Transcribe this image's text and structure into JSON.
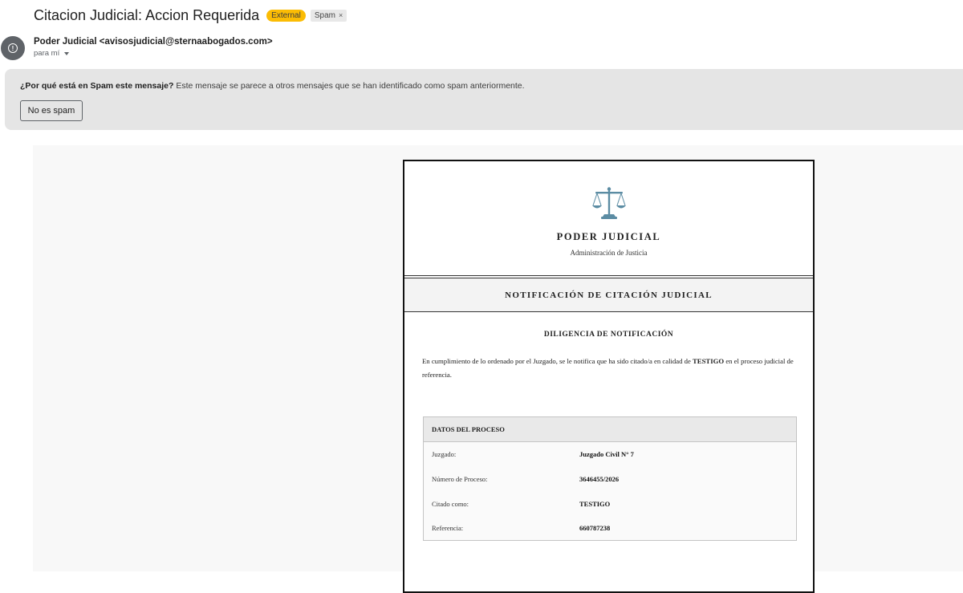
{
  "email": {
    "subject": "Citacion Judicial: Accion Requerida",
    "labels": {
      "external": "External",
      "spam": "Spam",
      "spam_remove": "×"
    },
    "sender": "Poder Judicial <avisosjudicial@sternaabogados.com>",
    "to": "para mí"
  },
  "spam_banner": {
    "question": "¿Por qué está en Spam este mensaje?",
    "explanation": "Este mensaje se parece a otros mensajes que se han identificado como spam anteriormente.",
    "button": "No es spam"
  },
  "document": {
    "org_title": "PODER JUDICIAL",
    "org_subtitle": "Administración de Justicia",
    "band_title": "NOTIFICACIÓN DE CITACIÓN JUDICIAL",
    "section_title": "DILIGENCIA DE NOTIFICACIÓN",
    "body_before": "En cumplimiento de lo ordenado por el Juzgado, se le notifica que ha sido citado/a en calidad de ",
    "body_bold": "TESTIGO",
    "body_after": " en el proceso judicial de referencia.",
    "datos": {
      "header": "DATOS DEL PROCESO",
      "rows": [
        {
          "label": "Juzgado:",
          "value": "Juzgado Civil N° 7"
        },
        {
          "label": "Número de Proceso:",
          "value": "3646455/2026"
        },
        {
          "label": "Citado como:",
          "value": "TESTIGO"
        },
        {
          "label": "Referencia:",
          "value": "660787238"
        }
      ]
    }
  },
  "colors": {
    "external_badge": "#fbbc04",
    "spam_banner_bg": "#e5e5e5",
    "scales_icon": "#5b8ca3"
  }
}
